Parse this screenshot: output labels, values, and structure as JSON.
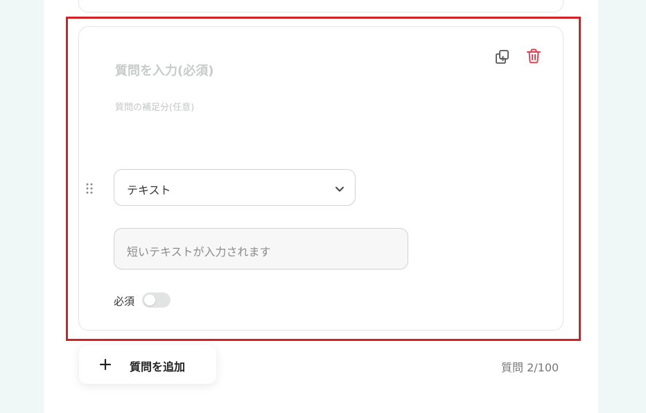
{
  "question": {
    "title_placeholder": "質問を入力(必須)",
    "description_placeholder": "質問の補足分(任意)",
    "type_selected": "テキスト",
    "answer_preview": "短いテキストが入力されます",
    "required_label": "必須",
    "required": false
  },
  "toolbar": {
    "duplicate_icon": "duplicate-icon",
    "delete_icon": "trash-icon"
  },
  "footer": {
    "add_question_label": "質問を追加",
    "counter": "質問 2/100"
  },
  "colors": {
    "background": "#eff8f7",
    "highlight": "#d61f1f",
    "delete": "#e23b4a"
  }
}
